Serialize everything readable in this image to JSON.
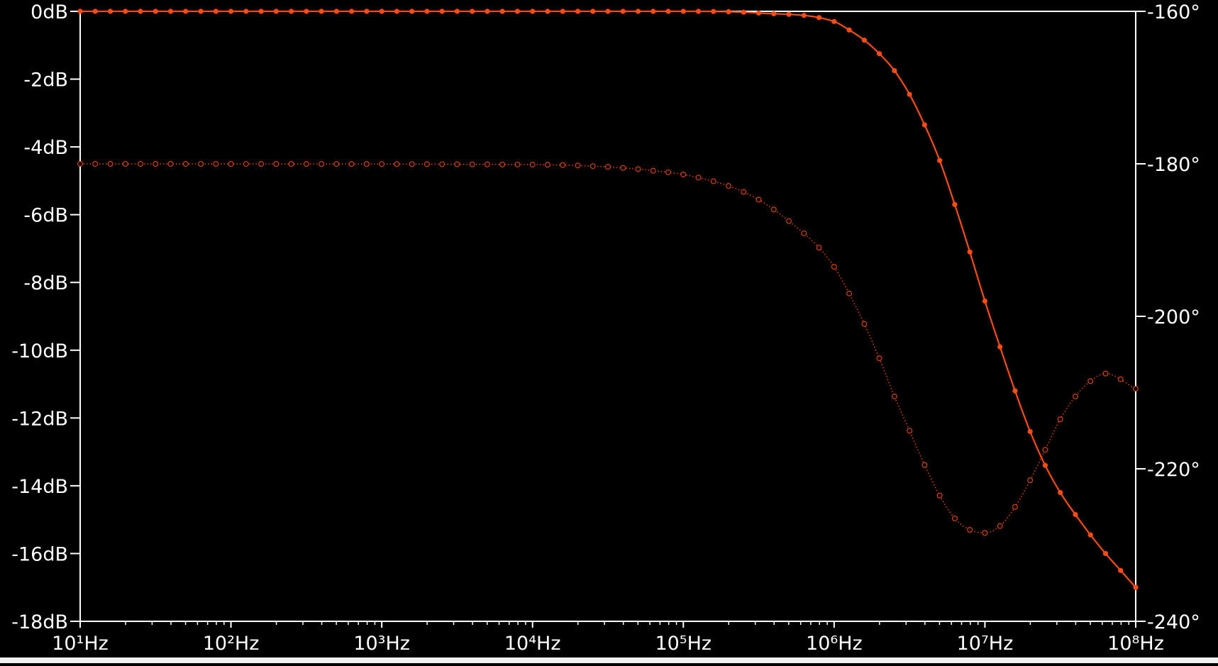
{
  "chart_data": {
    "type": "line",
    "x_scale": "log",
    "xlim": [
      10,
      100000000
    ],
    "x_ticks": [
      10,
      100,
      1000,
      10000,
      100000,
      1000000,
      10000000,
      100000000
    ],
    "x_tick_labels": [
      "10¹Hz",
      "10²Hz",
      "10³Hz",
      "10⁴Hz",
      "10⁵Hz",
      "10⁶Hz",
      "10⁷Hz",
      "10⁸Hz"
    ],
    "y_left": {
      "lim": [
        -18,
        0
      ],
      "ticks": [
        0,
        -2,
        -4,
        -6,
        -8,
        -10,
        -12,
        -14,
        -16,
        -18
      ],
      "tick_labels": [
        "0dB",
        "-2dB",
        "-4dB",
        "-6dB",
        "-8dB",
        "-10dB",
        "-12dB",
        "-14dB",
        "-16dB",
        "-18dB"
      ]
    },
    "y_right": {
      "lim": [
        -240,
        -160
      ],
      "ticks": [
        -160,
        -180,
        -200,
        -220,
        -240
      ],
      "tick_labels": [
        "-160°",
        "-180°",
        "-200°",
        "-220°",
        "-240°"
      ]
    },
    "grid": false,
    "series": [
      {
        "style": "solid",
        "axis": "left",
        "color": "#ff4a14",
        "x": [
          10,
          100000,
          316228,
          1000000,
          1258925,
          1584893,
          1995262,
          2511886,
          3162278,
          3981072,
          5011872,
          6309573,
          7943282,
          10000000,
          12589254,
          15848932,
          19952623,
          25118864,
          31622777,
          39810717,
          50118723,
          63095734,
          79432823,
          100000000
        ],
        "y": [
          0,
          0,
          -0.05,
          -0.3,
          -0.55,
          -0.85,
          -1.25,
          -1.75,
          -2.45,
          -3.35,
          -4.4,
          -5.7,
          -7.1,
          -8.55,
          -9.9,
          -11.2,
          -12.4,
          -13.4,
          -14.2,
          -14.85,
          -15.45,
          -16.0,
          -16.5,
          -17.0
        ]
      },
      {
        "style": "dotted",
        "axis": "right",
        "color": "#d8400f",
        "x": [
          10,
          10000,
          31623,
          63096,
          100000,
          199526,
          316228,
          501187,
          794328,
          1000000,
          1258925,
          1584893,
          1995262,
          2511886,
          3162278,
          3981072,
          5011872,
          6309573,
          7943282,
          10000000,
          12589254,
          15848932,
          19952623,
          25118864,
          31622777,
          39810717,
          50118723,
          63095734,
          100000000
        ],
        "y": [
          -180,
          -180.1,
          -180.4,
          -180.9,
          -181.4,
          -182.9,
          -184.7,
          -187.5,
          -191.0,
          -193.5,
          -197.0,
          -201.0,
          -205.5,
          -210.5,
          -215.0,
          -219.5,
          -223.5,
          -226.5,
          -228.0,
          -228.4,
          -227.5,
          -225.0,
          -221.5,
          -217.5,
          -213.5,
          -210.5,
          -208.5,
          -207.5,
          -209.5
        ]
      }
    ]
  },
  "colors": {
    "background": "#000000",
    "axis": "#ffffff",
    "bottom_strip": "#f0f0f0"
  }
}
